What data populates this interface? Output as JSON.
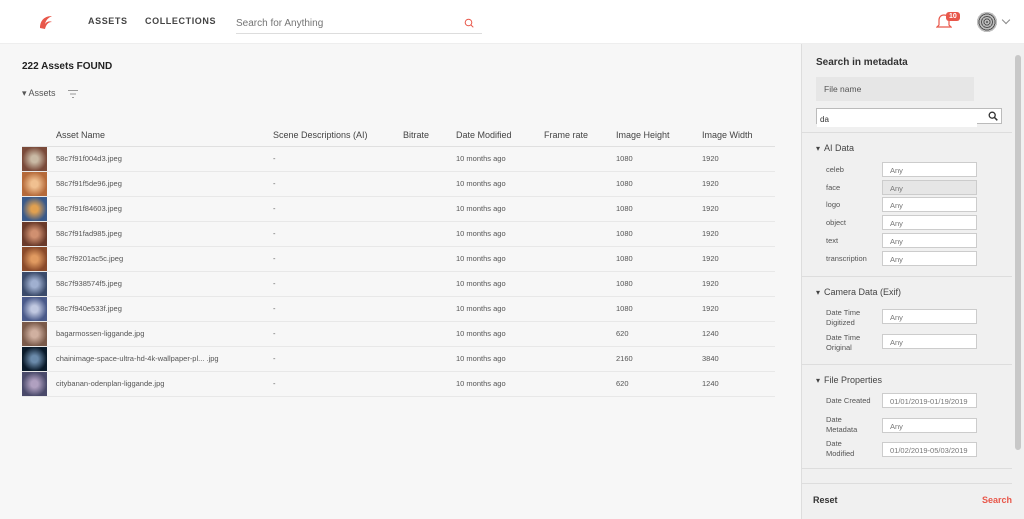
{
  "nav": {
    "assets": "ASSETS",
    "collections": "COLLECTIONS"
  },
  "search": {
    "placeholder": "Search for Anything"
  },
  "notifications": {
    "count": "10"
  },
  "summary": {
    "found": "222 Assets FOUND",
    "group_label": "Assets"
  },
  "table": {
    "columns": [
      "Asset Name",
      "Scene Descriptions (AI)",
      "Bitrate",
      "Date Modified",
      "Frame rate",
      "Image Height",
      "Image Width"
    ],
    "rows": [
      {
        "name": "58c7f91f004d3.jpeg",
        "scene": "-",
        "bitrate": "",
        "modified": "10 months ago",
        "frame": "",
        "height": "1080",
        "width": "1920"
      },
      {
        "name": "58c7f91f5de96.jpeg",
        "scene": "-",
        "bitrate": "",
        "modified": "10 months ago",
        "frame": "",
        "height": "1080",
        "width": "1920"
      },
      {
        "name": "58c7f91f84603.jpeg",
        "scene": "-",
        "bitrate": "",
        "modified": "10 months ago",
        "frame": "",
        "height": "1080",
        "width": "1920"
      },
      {
        "name": "58c7f91fad985.jpeg",
        "scene": "-",
        "bitrate": "",
        "modified": "10 months ago",
        "frame": "",
        "height": "1080",
        "width": "1920"
      },
      {
        "name": "58c7f9201ac5c.jpeg",
        "scene": "-",
        "bitrate": "",
        "modified": "10 months ago",
        "frame": "",
        "height": "1080",
        "width": "1920"
      },
      {
        "name": "58c7f938574f5.jpeg",
        "scene": "-",
        "bitrate": "",
        "modified": "10 months ago",
        "frame": "",
        "height": "1080",
        "width": "1920"
      },
      {
        "name": "58c7f940e533f.jpeg",
        "scene": "-",
        "bitrate": "",
        "modified": "10 months ago",
        "frame": "",
        "height": "1080",
        "width": "1920"
      },
      {
        "name": "bagarmossen-liggande.jpg",
        "scene": "-",
        "bitrate": "",
        "modified": "10 months ago",
        "frame": "",
        "height": "620",
        "width": "1240"
      },
      {
        "name": "chainimage-space-ultra-hd-4k-wallpaper-pl... .jpg",
        "scene": "-",
        "bitrate": "",
        "modified": "10 months ago",
        "frame": "",
        "height": "2160",
        "width": "3840"
      },
      {
        "name": "citybanan-odenplan-liggande.jpg",
        "scene": "-",
        "bitrate": "",
        "modified": "10 months ago",
        "frame": "",
        "height": "620",
        "width": "1240"
      }
    ]
  },
  "sidebar": {
    "title": "Search in metadata",
    "file_name_label": "File name",
    "query": "da",
    "ai_section": "AI Data",
    "ai_fields": [
      {
        "label": "celeb",
        "value": "Any"
      },
      {
        "label": "face",
        "value": "Any"
      },
      {
        "label": "logo",
        "value": "Any"
      },
      {
        "label": "object",
        "value": "Any"
      },
      {
        "label": "text",
        "value": "Any"
      },
      {
        "label": "transcription",
        "value": "Any"
      }
    ],
    "camera_section": "Camera Data (Exif)",
    "camera_fields": [
      {
        "label1": "Date Time",
        "label2": "Digitized",
        "value": "Any"
      },
      {
        "label1": "Date Time",
        "label2": "Original",
        "value": "Any"
      }
    ],
    "file_section": "File Properties",
    "file_fields": [
      {
        "label1": "Date Created",
        "label2": "",
        "value": "01/01/2019-01/19/2019"
      },
      {
        "label1": "Date",
        "label2": "Metadata",
        "value": "Any"
      },
      {
        "label1": "Date",
        "label2": "Modified",
        "value": "01/02/2019-05/03/2019"
      }
    ],
    "reset_label": "Reset",
    "search_label": "Search"
  },
  "colors": {
    "accent": "#e8574a"
  },
  "icons": {
    "logo": "brand-swirl-icon",
    "search": "search-icon",
    "bell": "bell-icon",
    "filter": "filter-icon",
    "magnifier": "magnifier-icon"
  }
}
